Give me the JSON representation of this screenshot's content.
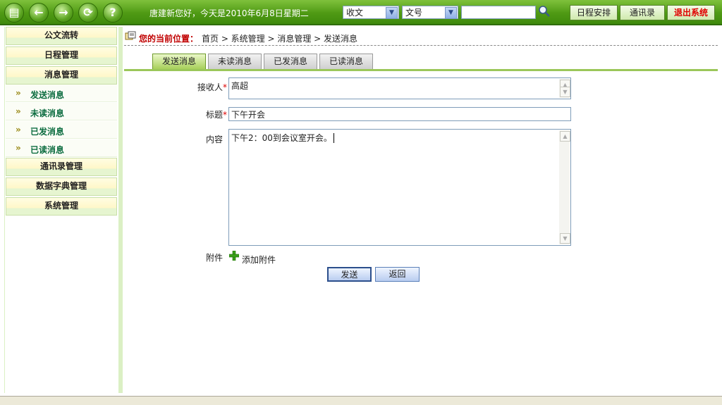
{
  "header": {
    "nav_buttons": [
      {
        "icon": "document-icon",
        "glyph": "▤"
      },
      {
        "icon": "back-icon",
        "glyph": "←"
      },
      {
        "icon": "forward-icon",
        "glyph": "→"
      },
      {
        "icon": "refresh-icon",
        "glyph": "⟳"
      },
      {
        "icon": "help-icon",
        "glyph": "?"
      }
    ],
    "greeting": "唐建新您好，今天是2010年6月8日星期二",
    "category_select": "收文",
    "field_select": "文号",
    "search_value": "",
    "schedule_button": "日程安排",
    "contacts_button": "通讯录",
    "exit_button": "退出系统"
  },
  "sidebar": {
    "groups": [
      {
        "label": "公文流转"
      },
      {
        "label": "日程管理"
      },
      {
        "label": "消息管理"
      }
    ],
    "items": [
      {
        "label": "发送消息"
      },
      {
        "label": "未读消息"
      },
      {
        "label": "已发消息"
      },
      {
        "label": "已读消息"
      }
    ],
    "groups_after": [
      {
        "label": "通讯录管理"
      },
      {
        "label": "数据字典管理"
      },
      {
        "label": "系统管理"
      }
    ],
    "chevron": "»"
  },
  "breadcrumb": {
    "lead": "您的当前位置：",
    "path": "首页  > 系统管理  > 消息管理  > 发送消息"
  },
  "tabs": [
    {
      "label": "发送消息",
      "active": true
    },
    {
      "label": "未读消息",
      "active": false
    },
    {
      "label": "已发消息",
      "active": false
    },
    {
      "label": "已读消息",
      "active": false
    }
  ],
  "form": {
    "recipient_label": "接收人",
    "recipient_value": "高超",
    "title_label": "标题",
    "title_value": "下午开会",
    "content_label": "内容",
    "content_value": "下午2：00到会议室开会。",
    "required_mark": "*",
    "attachment_label": "附件",
    "add_attachment": "添加附件",
    "send_button": "发送",
    "back_button": "返回"
  },
  "colors": {
    "header_green": "#4f9a14",
    "exit_red": "#e00000",
    "menu_text": "#0d6d40",
    "breadcrumb_red": "#c00000"
  }
}
